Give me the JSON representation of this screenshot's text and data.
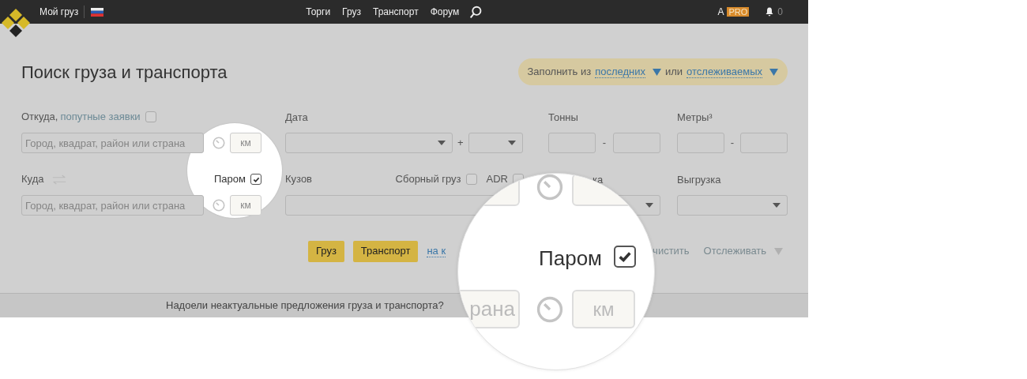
{
  "header": {
    "my_cargo": "Мой груз",
    "nav": [
      "Торги",
      "Груз",
      "Транспорт",
      "Форум"
    ],
    "user": "А",
    "badge": "PRO",
    "notifications": "0"
  },
  "title": "Поиск груза и транспорта",
  "fill_from": {
    "prefix": "Заполнить из",
    "recent": "последних",
    "or": "или",
    "tracked": "отслеживаемых"
  },
  "row1": {
    "from_label": "Откуда,",
    "along_link": "попутные заявки",
    "along_checked": false,
    "from_placeholder": "Город, квадрат, район или страна",
    "km_placeholder": "км",
    "date_label": "Дата",
    "plus": "+",
    "tons_label": "Тонны",
    "dash": "-",
    "meters_label": "Метры³"
  },
  "row2": {
    "to_label": "Куда",
    "ferry_label": "Паром",
    "ferry_checked": true,
    "to_placeholder": "Город, квадрат, район или страна",
    "km_placeholder": "км",
    "body_label": "Кузов",
    "groupage_label": "Сборный груз",
    "groupage_checked": false,
    "adr_label": "ADR",
    "adr_checked": false,
    "loading_label": "ка",
    "unloading_label": "Выгрузка"
  },
  "actions": {
    "cargo_button": "Груз",
    "transport_button": "Транспорт",
    "map_link": "на к",
    "clear_link": "чистить",
    "track_link": "Отслеживать"
  },
  "notice": "Надоели неактуальные предложения груза и транспорта?",
  "magnifier": {
    "ferry_label": "Паром",
    "ferry_checked": true,
    "place_fragment": "рана",
    "km": "км"
  }
}
